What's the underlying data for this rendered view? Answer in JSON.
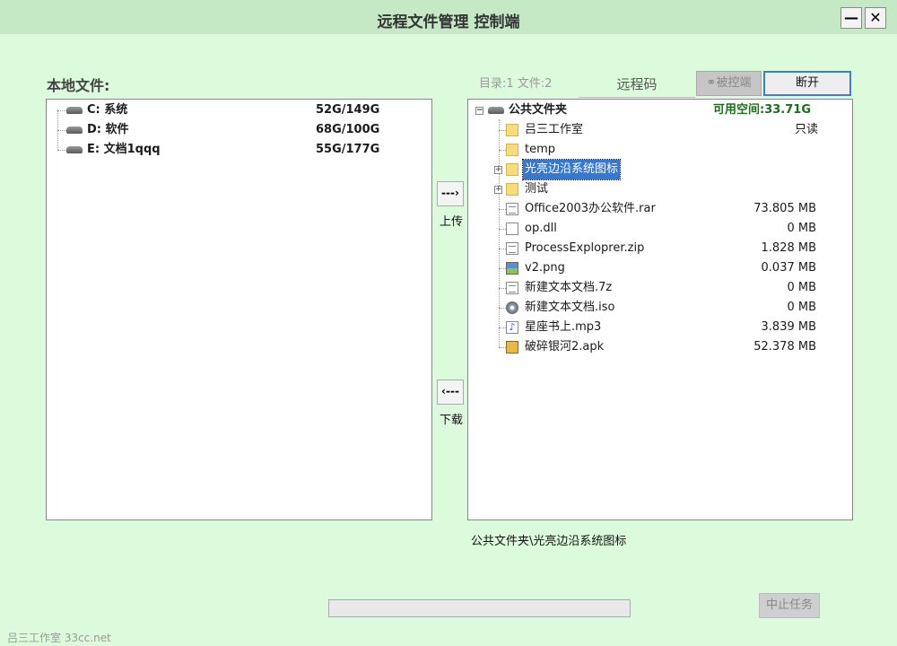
{
  "window": {
    "title": "远程文件管理 控制端",
    "minimize_label": "—",
    "close_label": "✕"
  },
  "local": {
    "label": "本地文件:",
    "drives": [
      {
        "label": "C:  系统",
        "size": "52G/149G"
      },
      {
        "label": "D:  软件",
        "size": "68G/100G"
      },
      {
        "label": "E:  文档1qqq",
        "size": "55G/177G"
      }
    ]
  },
  "transfer": {
    "upload_arrow": "---›",
    "upload_label": "上传",
    "download_arrow": "‹---",
    "download_label": "下载"
  },
  "remote": {
    "stats": "目录:1   文件:2",
    "tab_label": "远程码",
    "controlled_label": "被控端",
    "disconnect_label": "断开",
    "root": {
      "label": "公共文件夹",
      "free": "可用空间:33.71G",
      "expand": "−"
    },
    "items": [
      {
        "name": "吕三工作室",
        "type": "special-folder",
        "extra": "只读",
        "size": ""
      },
      {
        "name": "temp",
        "type": "folder",
        "size": "",
        "extra": ""
      },
      {
        "name": "光亮边沿系统图标",
        "type": "folder-open",
        "size": "",
        "extra": "",
        "expandable": true,
        "selected": true
      },
      {
        "name": "测试",
        "type": "folder",
        "size": "",
        "extra": "",
        "expandable": true
      },
      {
        "name": "Office2003办公软件.rar",
        "type": "archive",
        "size": "73.805 MB",
        "extra": ""
      },
      {
        "name": "op.dll",
        "type": "file",
        "size": "0 MB",
        "extra": ""
      },
      {
        "name": "ProcessExplopr­er.zip",
        "type": "archive",
        "size": "1.828 MB",
        "extra": ""
      },
      {
        "name": "v2.png",
        "type": "image",
        "size": "0.037 MB",
        "extra": ""
      },
      {
        "name": "新建文本文档.7z",
        "type": "archive",
        "size": "0 MB",
        "extra": ""
      },
      {
        "name": "新建文本文档.iso",
        "type": "disc",
        "size": "0 MB",
        "extra": ""
      },
      {
        "name": "星座书上.mp3",
        "type": "audio",
        "size": "3.839 MB",
        "extra": ""
      },
      {
        "name": "破碎银河2.apk",
        "type": "apk",
        "size": "52.378 MB",
        "extra": ""
      }
    ],
    "current_path": "公共文件夹\\光亮边沿系统图标"
  },
  "task": {
    "progress": 0,
    "stop_label": "中止任务"
  },
  "footer": {
    "text": "吕三工作室 33cc.net"
  },
  "icons": {
    "drive": "hard-drive-icon",
    "folder": "folder-icon",
    "file": "file-icon"
  }
}
